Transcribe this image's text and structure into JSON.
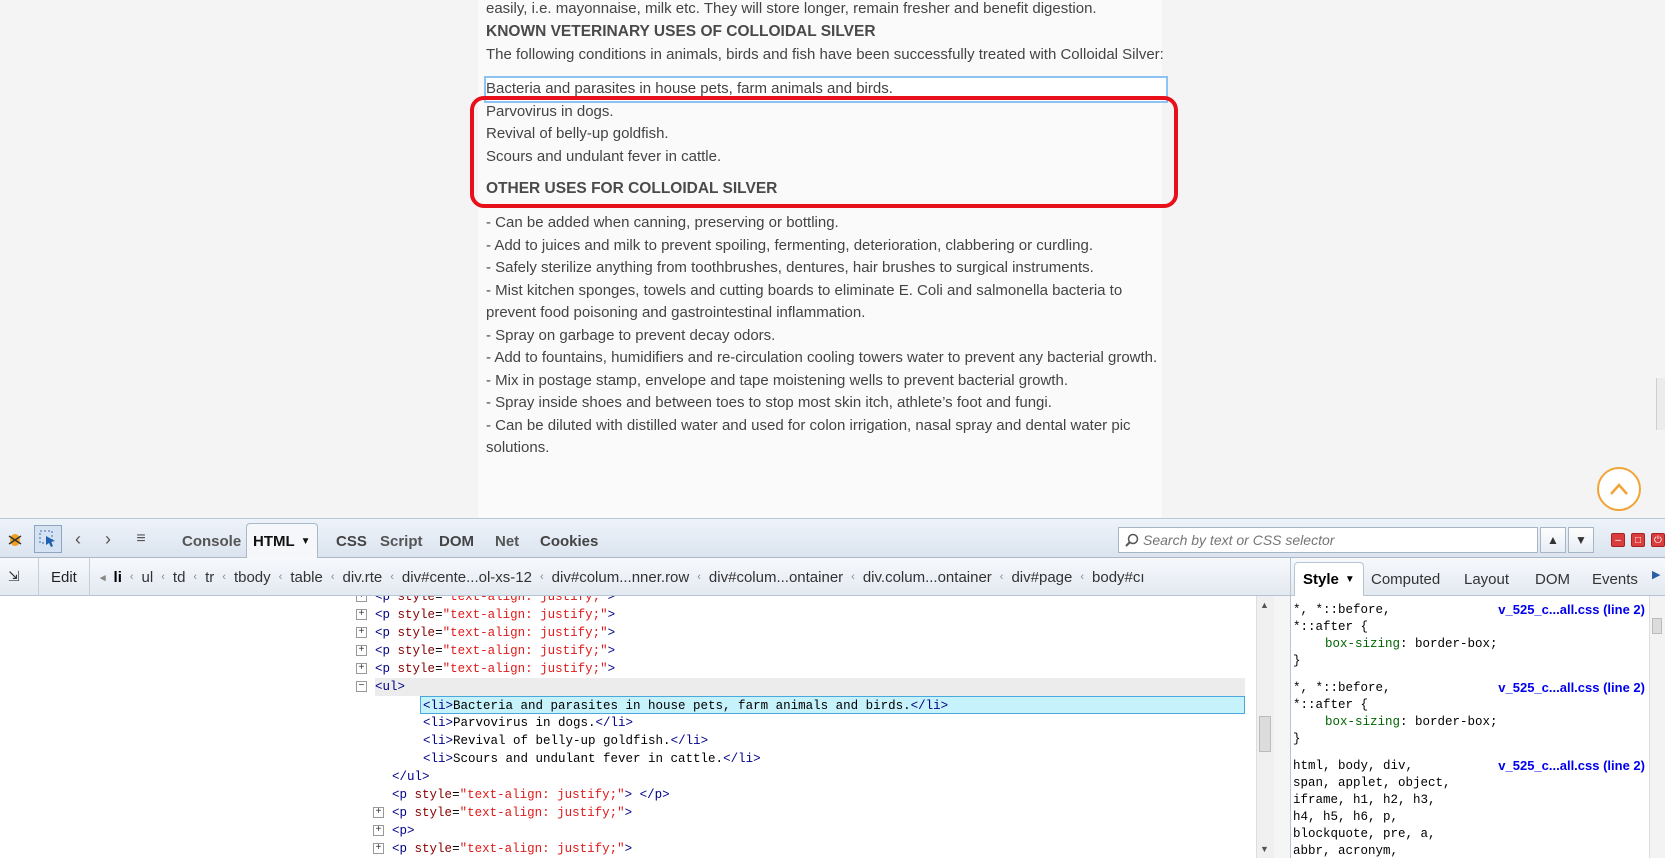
{
  "page": {
    "top_text": "easily, i.e. mayonnaise, milk etc. They will store longer, remain fresher and benefit digestion.",
    "vet_heading": "KNOWN VETERINARY USES OF COLLOIDAL SILVER",
    "vet_intro": "The following conditions in animals, birds and fish have been successfully treated with Colloidal Silver:",
    "vet_items": [
      "Bacteria and parasites in house pets, farm animals and birds.",
      "Parvovirus in dogs.",
      "Revival of belly-up goldfish.",
      "Scours and undulant fever in cattle."
    ],
    "other_heading": "OTHER USES FOR COLLOIDAL SILVER",
    "other_items": [
      "- Can be added when canning, preserving or bottling.",
      "- Add to juices and milk to prevent spoiling, fermenting, deterioration, clabbering or curdling.",
      "- Safely sterilize anything from toothbrushes, dentures, hair brushes to surgical instruments.",
      "- Mist kitchen sponges, towels and cutting boards to eliminate E. Coli and salmonella bacteria to prevent food poisoning and gastrointestinal inflammation.",
      "- Spray on garbage to prevent decay odors.",
      "- Add to fountains, humidifiers and re-circulation cooling towers water to prevent any bacterial growth.",
      "- Mix in postage stamp, envelope and tape moistening wells to prevent bacterial growth.",
      "- Spray inside shoes and between toes to stop most skin itch, athlete’s foot and fungi.",
      "- Can be diluted with distilled water and used for colon irrigation, nasal spray and dental water pic solutions."
    ],
    "highlight_color": "#e8101b",
    "scroll_top_color": "#f0a437"
  },
  "firebug": {
    "tabs": [
      "Console",
      "HTML",
      "CSS",
      "Script",
      "DOM",
      "Net",
      "Cookies"
    ],
    "active_tab": "HTML",
    "search_placeholder": "Search by text or CSS selector",
    "edit_label": "Edit",
    "breadcrumbs": [
      "li",
      "ul",
      "td",
      "tr",
      "tbody",
      "table",
      "div.rte",
      "div#cente...ol-xs-12",
      "div#colum...nner.row",
      "div#colum...ontainer",
      "div.colum...ontainer",
      "div#page",
      "body#cı"
    ],
    "side_tabs": [
      "Style",
      "Computed",
      "Layout",
      "DOM",
      "Events"
    ],
    "active_side_tab": "Style",
    "tree": {
      "p_tag": "p",
      "style_attr": "style",
      "justify_value": "\"text-align: justify;\"",
      "ul_tag": "ul",
      "li_items": [
        "Bacteria and parasites in house pets, farm animals and birds.",
        "Parvovirus in dogs.",
        "Revival of belly-up goldfish.",
        "Scours and undulant fever in cattle."
      ]
    },
    "style_rules": [
      {
        "selector": "*, *::before,\n*::after {",
        "source": "v_525_c...all.css (line 2)",
        "prop": "box-sizing",
        "value": "border-box;"
      },
      {
        "selector": "*, *::before,\n*::after {",
        "source": "v_525_c...all.css (line 2)",
        "prop": "box-sizing",
        "value": "border-box;"
      },
      {
        "selector": "html, body, div,\nspan, applet, object,\niframe, h1, h2, h3,\nh4, h5, h6, p,\nblockquote, pre, a,\nabbr, acronym,",
        "source": "v_525_c...all.css (line 2)"
      }
    ]
  }
}
